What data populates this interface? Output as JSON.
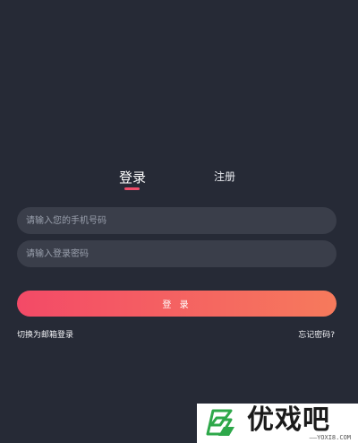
{
  "tabs": {
    "login_label": "登录",
    "register_label": "注册"
  },
  "form": {
    "phone_placeholder": "请输入您的手机号码",
    "password_placeholder": "请输入登录密码",
    "submit_label": "登 录"
  },
  "links": {
    "switch_email_label": "切换为邮箱登录",
    "forgot_password_label": "忘记密码?"
  },
  "watermark": {
    "site_name": "优戏吧",
    "url": "——YOXI8.COM"
  },
  "colors": {
    "background": "#262a36",
    "input_background": "#3a3e4a",
    "accent_start": "#f34a67",
    "accent_end": "#f67a5c",
    "tab_underline": "#f14d6a"
  }
}
